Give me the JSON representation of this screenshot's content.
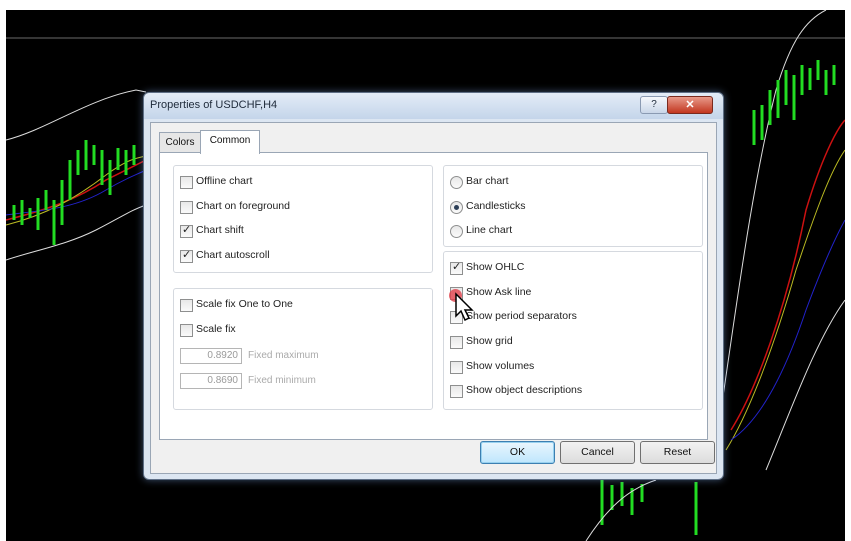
{
  "dialog": {
    "title": "Properties of USDCHF,H4",
    "help_label": "?",
    "close_label": "✕",
    "tabs": [
      {
        "label": "Colors"
      },
      {
        "label": "Common"
      }
    ],
    "chart_options": [
      {
        "label": "Offline chart",
        "checked": false
      },
      {
        "label": "Chart on foreground",
        "checked": false
      },
      {
        "label": "Chart shift",
        "checked": true
      },
      {
        "label": "Chart autoscroll",
        "checked": true
      }
    ],
    "scale_options": [
      {
        "label": "Scale fix One to One",
        "checked": false
      },
      {
        "label": "Scale fix",
        "checked": false
      }
    ],
    "fixed_maximum": {
      "value": "0.8920",
      "label": "Fixed maximum"
    },
    "fixed_minimum": {
      "value": "0.8690",
      "label": "Fixed minimum"
    },
    "chart_type": [
      {
        "label": "Bar chart",
        "selected": false
      },
      {
        "label": "Candlesticks",
        "selected": true
      },
      {
        "label": "Line chart",
        "selected": false
      }
    ],
    "show_options": [
      {
        "label": "Show OHLC",
        "checked": true
      },
      {
        "label": "Show Ask line",
        "checked": false
      },
      {
        "label": "Show period separators",
        "checked": false
      },
      {
        "label": "Show grid",
        "checked": false
      },
      {
        "label": "Show volumes",
        "checked": false
      },
      {
        "label": "Show object descriptions",
        "checked": false
      }
    ],
    "buttons": {
      "ok": "OK",
      "cancel": "Cancel",
      "reset": "Reset"
    },
    "check_mark": "✓"
  },
  "colors": {
    "chart_background": "#000000",
    "candle": "#22dd22",
    "band_line": "#ffffff",
    "ma_red": "#cc1111",
    "ma_yellow": "#bbbb22",
    "ma_blue": "#2222cc",
    "click_indicator": "#e0404a"
  }
}
